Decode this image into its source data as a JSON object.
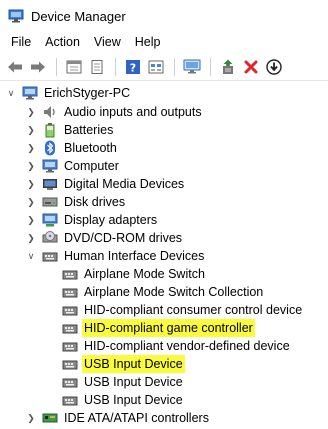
{
  "window": {
    "title": "Device Manager"
  },
  "menu": {
    "items": [
      "File",
      "Action",
      "View",
      "Help"
    ]
  },
  "toolbar": {
    "buttons": [
      "back-icon",
      "forward-icon",
      "properties-window-icon",
      "properties-sheet-icon",
      "help-icon",
      "show-hidden-icon",
      "scan-hardware-icon",
      "update-driver-icon",
      "uninstall-icon",
      "disable-device-icon"
    ]
  },
  "colors": {
    "highlight": "#fbfb3e",
    "uninstall_red": "#e0242a",
    "back_green": "#2f8a3a"
  },
  "tree": {
    "root": {
      "label": "ErichStyger-PC",
      "expander": "expanded"
    },
    "categories": [
      {
        "label": "Audio inputs and outputs",
        "icon": "speaker-icon"
      },
      {
        "label": "Batteries",
        "icon": "battery-icon"
      },
      {
        "label": "Bluetooth",
        "icon": "bluetooth-icon"
      },
      {
        "label": "Computer",
        "icon": "computer-icon"
      },
      {
        "label": "Digital Media Devices",
        "icon": "media-device-icon"
      },
      {
        "label": "Disk drives",
        "icon": "disk-drive-icon"
      },
      {
        "label": "Display adapters",
        "icon": "display-adapter-icon"
      },
      {
        "label": "DVD/CD-ROM drives",
        "icon": "dvd-drive-icon"
      }
    ],
    "hid_category": {
      "label": "Human Interface Devices",
      "icon": "hid-icon",
      "expander": "expanded"
    },
    "hid_devices": [
      {
        "label": "Airplane Mode Switch",
        "highlighted": false
      },
      {
        "label": "Airplane Mode Switch Collection",
        "highlighted": false
      },
      {
        "label": "HID-compliant consumer control device",
        "highlighted": false
      },
      {
        "label": "HID-compliant game controller",
        "highlighted": true
      },
      {
        "label": "HID-compliant vendor-defined device",
        "highlighted": false
      },
      {
        "label": "USB Input Device",
        "highlighted": true
      },
      {
        "label": "USB Input Device",
        "highlighted": false
      },
      {
        "label": "USB Input Device",
        "highlighted": false
      }
    ],
    "last_category": {
      "label": "IDE ATA/ATAPI controllers",
      "icon": "ide-controller-icon"
    }
  }
}
